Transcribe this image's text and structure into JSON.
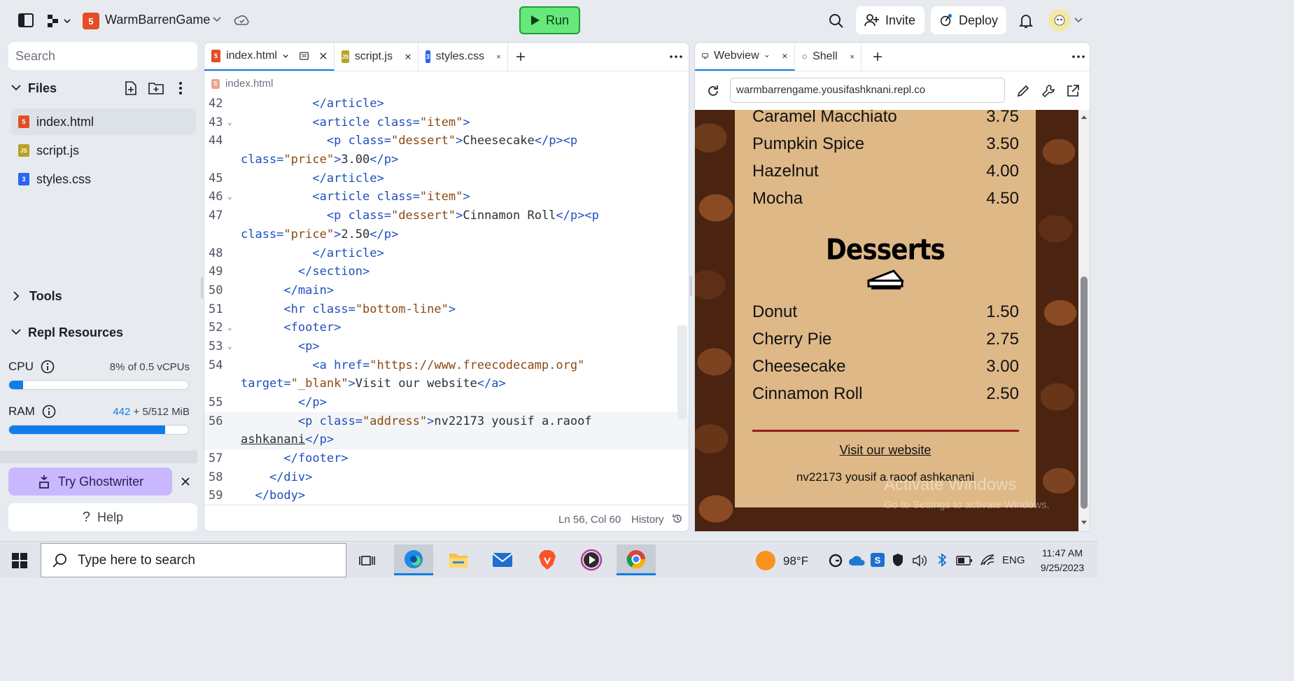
{
  "topbar": {
    "project_name": "WarmBarrenGame",
    "run_label": "Run",
    "invite_label": "Invite",
    "deploy_label": "Deploy"
  },
  "sidebar": {
    "search_placeholder": "Search",
    "files_label": "Files",
    "files": [
      {
        "name": "index.html",
        "type": "html"
      },
      {
        "name": "script.js",
        "type": "js"
      },
      {
        "name": "styles.css",
        "type": "css"
      }
    ],
    "tools_label": "Tools",
    "resources_label": "Repl Resources",
    "cpu_label": "CPU",
    "cpu_value": "8% of 0.5 vCPUs",
    "cpu_fraction": 0.08,
    "ram_label": "RAM",
    "ram_used": "442",
    "ram_rest": " + 5/512 MiB",
    "ram_fraction": 0.87,
    "ghostwriter_label": "Try Ghostwriter",
    "help_label": "Help"
  },
  "editor": {
    "tabs": [
      {
        "label": "index.html"
      },
      {
        "label": "script.js"
      },
      {
        "label": "styles.css"
      }
    ],
    "path": "index.html",
    "status_position": "Ln 56, Col 60",
    "history_label": "History",
    "lines": [
      {
        "n": "42",
        "html": "          <span class=\"tg\">&lt;/article&gt;</span>"
      },
      {
        "n": "43",
        "fold": true,
        "html": "          <span class=\"tg\">&lt;article</span> <span class=\"at\">class=</span><span class=\"st\">\"item\"</span><span class=\"tg\">&gt;</span>"
      },
      {
        "n": "44",
        "html": "            <span class=\"tg\">&lt;p</span> <span class=\"at\">class=</span><span class=\"st\">\"dessert\"</span><span class=\"tg\">&gt;</span>Cheesecake<span class=\"tg\">&lt;/p&gt;&lt;p</span>"
      },
      {
        "n": "",
        "html": "<span class=\"at\">class=</span><span class=\"st\">\"price\"</span><span class=\"tg\">&gt;</span>3.00<span class=\"tg\">&lt;/p&gt;</span>"
      },
      {
        "n": "45",
        "html": "          <span class=\"tg\">&lt;/article&gt;</span>"
      },
      {
        "n": "46",
        "fold": true,
        "html": "          <span class=\"tg\">&lt;article</span> <span class=\"at\">class=</span><span class=\"st\">\"item\"</span><span class=\"tg\">&gt;</span>"
      },
      {
        "n": "47",
        "html": "            <span class=\"tg\">&lt;p</span> <span class=\"at\">class=</span><span class=\"st\">\"dessert\"</span><span class=\"tg\">&gt;</span>Cinnamon Roll<span class=\"tg\">&lt;/p&gt;&lt;p</span>"
      },
      {
        "n": "",
        "html": "<span class=\"at\">class=</span><span class=\"st\">\"price\"</span><span class=\"tg\">&gt;</span>2.50<span class=\"tg\">&lt;/p&gt;</span>"
      },
      {
        "n": "48",
        "html": "          <span class=\"tg\">&lt;/article&gt;</span>"
      },
      {
        "n": "49",
        "html": "        <span class=\"tg\">&lt;/section&gt;</span>"
      },
      {
        "n": "50",
        "html": "      <span class=\"tg\">&lt;/main&gt;</span>"
      },
      {
        "n": "51",
        "html": "      <span class=\"tg\">&lt;hr</span> <span class=\"at\">class=</span><span class=\"st\">\"bottom-line\"</span><span class=\"tg\">&gt;</span>"
      },
      {
        "n": "52",
        "fold": true,
        "html": "      <span class=\"tg\">&lt;footer&gt;</span>"
      },
      {
        "n": "53",
        "fold": true,
        "html": "        <span class=\"tg\">&lt;p&gt;</span>"
      },
      {
        "n": "54",
        "html": "          <span class=\"tg\">&lt;a</span> <span class=\"at\">href=</span><span class=\"st\">\"https://www.freecodecamp.org\"</span>"
      },
      {
        "n": "",
        "html": "<span class=\"at\">target=</span><span class=\"st\">\"_blank\"</span><span class=\"tg\">&gt;</span>Visit our website<span class=\"tg\">&lt;/a&gt;</span>"
      },
      {
        "n": "55",
        "html": "        <span class=\"tg\">&lt;/p&gt;</span>"
      },
      {
        "n": "56",
        "hl": true,
        "html": "        <span class=\"tg\">&lt;p</span> <span class=\"at\">class=</span><span class=\"st\">\"address\"</span><span class=\"tg\">&gt;</span>nv22173 yousif a.raoof"
      },
      {
        "n": "",
        "hl": true,
        "html": "<span style=\"text-decoration:underline\">ashkanani</span><span class=\"tg\">&lt;/p&gt;</span>"
      },
      {
        "n": "57",
        "html": "      <span class=\"tg\">&lt;/footer&gt;</span>"
      },
      {
        "n": "58",
        "html": "    <span class=\"tg\">&lt;/div&gt;</span>"
      },
      {
        "n": "59",
        "html": "  <span class=\"tg\">&lt;/body&gt;</span>"
      }
    ]
  },
  "webview": {
    "tab_label": "Webview",
    "shell_label": "Shell",
    "url": "warmbarrengame.yousifashknani.repl.co",
    "coffee_items": [
      {
        "name": "Caramel Macchiato",
        "price": "3.75"
      },
      {
        "name": "Pumpkin Spice",
        "price": "3.50"
      },
      {
        "name": "Hazelnut",
        "price": "4.00"
      },
      {
        "name": "Mocha",
        "price": "4.50"
      }
    ],
    "desserts_title": "Desserts",
    "desserts": [
      {
        "name": "Donut",
        "price": "1.50"
      },
      {
        "name": "Cherry Pie",
        "price": "2.75"
      },
      {
        "name": "Cheesecake",
        "price": "3.00"
      },
      {
        "name": "Cinnamon Roll",
        "price": "2.50"
      }
    ],
    "link_text": "Visit our website",
    "address": "nv22173 yousif a.raoof ashkanani",
    "watermark_title": "Activate Windows",
    "watermark_sub": "Go to Settings to activate Windows."
  },
  "taskbar": {
    "search_placeholder": "Type here to search",
    "weather": "98°F",
    "language": "ENG",
    "time": "11:47 AM",
    "date": "9/25/2023"
  },
  "colors": {
    "run_green": "#66e87a",
    "accent_blue": "#0f7ce8",
    "menu_card": "#deb887",
    "divider_red": "#9b1c1c",
    "ghostwriter": "#c9b8ff"
  }
}
